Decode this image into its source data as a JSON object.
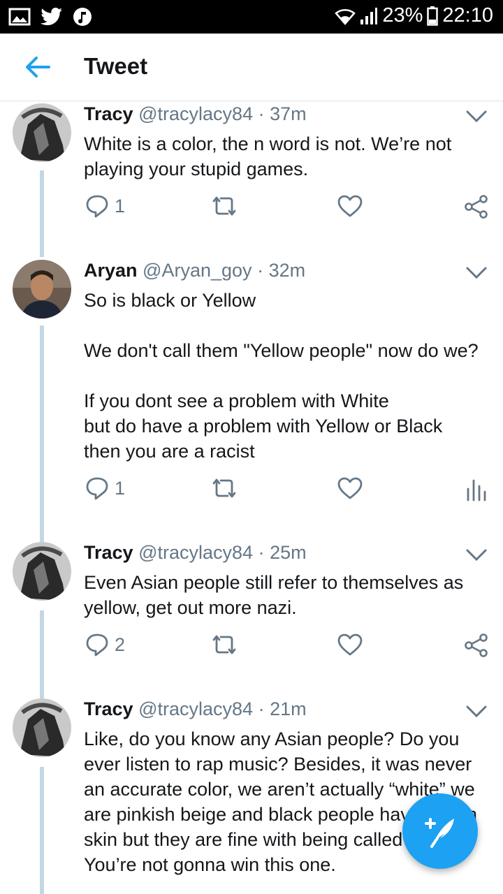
{
  "status_bar": {
    "battery": "23%",
    "time": "22:10"
  },
  "header": {
    "title": "Tweet"
  },
  "tweets": [
    {
      "name": "Tracy",
      "handle": "@tracylacy84",
      "time": "37m",
      "sep": "·",
      "text": "White is a color, the n word is not. We’re not playing your stupid games.",
      "reply_count": "1"
    },
    {
      "name": "Aryan",
      "handle": "@Aryan_goy",
      "time": "32m",
      "sep": "·",
      "text": "So is black or Yellow\n\nWe don't call them \"Yellow people\" now do we?\n\nIf you dont see a problem with White\nbut do have a problem with Yellow or Black\nthen you are a racist",
      "reply_count": "1"
    },
    {
      "name": "Tracy",
      "handle": "@tracylacy84",
      "time": "25m",
      "sep": "·",
      "text": "Even Asian people still refer to themselves as yellow, get out more nazi.",
      "reply_count": "2"
    },
    {
      "name": "Tracy",
      "handle": "@tracylacy84",
      "time": "21m",
      "sep": "·",
      "text": "Like, do you know any Asian people? Do you ever listen to rap music? Besides, it was never an accurate color, we aren’t actually “white” we are pinkish beige and black people have brown skin but they are fine with being called black. You’re not gonna win this one.",
      "reply_count": ""
    }
  ],
  "colors": {
    "accent": "#1da1f2",
    "thread": "#c4d7e3",
    "muted": "#657786"
  }
}
